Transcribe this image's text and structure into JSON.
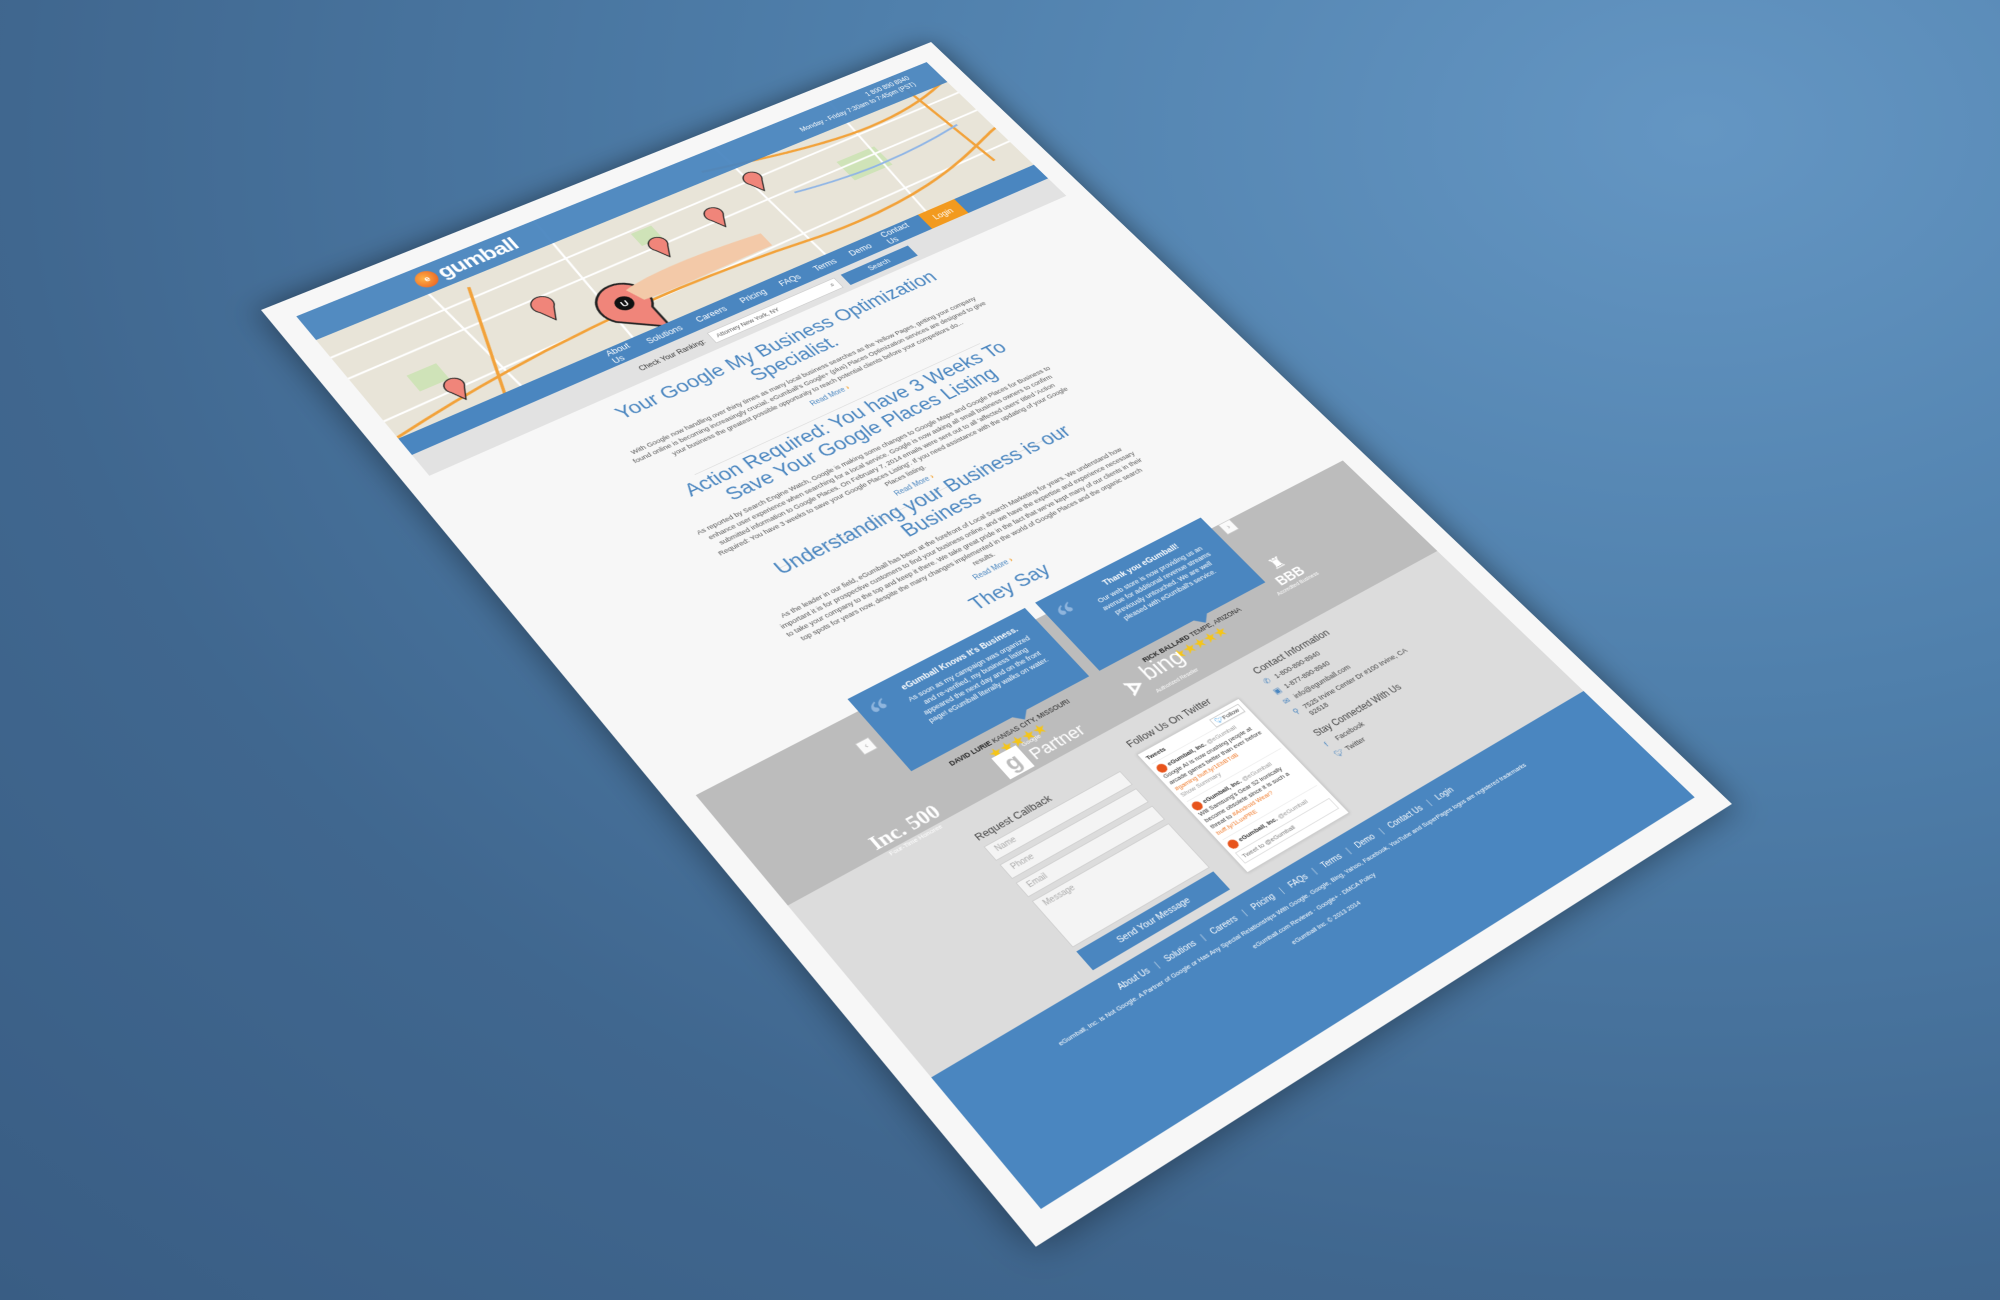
{
  "header": {
    "logo": "gumball",
    "logo_mark": "e",
    "phone": "1 800 890 8940",
    "hours": "Monday - Friday 7:30am to 7:45pm (PST)"
  },
  "nav": {
    "items": [
      "About Us",
      "Solutions",
      "Careers",
      "Pricing",
      "FAQs",
      "Terms",
      "Demo",
      "Contact Us"
    ],
    "login": "Login"
  },
  "ranking": {
    "label": "Check Your Ranking:",
    "value": "Attorney New York, NY",
    "button": "Search"
  },
  "articles": [
    {
      "title": "Your Google My Business Optimization Specialist.",
      "body": "With Google now handling over thirty times as many local business searches as the Yellow Pages, getting your company found online is becoming increasingly crucial. eGumball's Google+ (plus) Places Optimization services are designed to give your business the greatest possible opportunity to reach potential clients before your competitors do...",
      "more": "Read More"
    },
    {
      "title": "Action Required: You have 3 Weeks To Save Your Google Places Listing",
      "body": "As reported by Search Engine Watch, Google is making some changes to Google Maps and Google Places for Business to enhance user experience when searching for a local service. Google is now asking all small business owners to confirm submitted information to Google Places. On February 7, 2014 emails were sent out to all 'affected users' titled 'Action Required: You have 3 weeks to save your Google Places Listing'. If you need assistance with the updating of your Google Places listing.",
      "more": "Read More"
    },
    {
      "title": "Understanding your Business is our Business",
      "body": "As the leader in our field, eGumball has been at the forefront of Local Search Marketing for years. We understand how important it is for prospective customers to find your business online, and we have the expertise and experience necessary to take your company to the top and keep it there. We take great pride in the fact that we've kept many of our clients in their top spots for years now, despite the many changes implemented in the world of Google Places and the organic search results.",
      "more": "Read More"
    }
  ],
  "testimonials": {
    "title": "They Say",
    "items": [
      {
        "heading": "eGumball Knows It's Business.",
        "text": "As soon as my campaign was organized and re-verified, my business listing appeared the next day and on the front page! eGumball literally walks on water.",
        "name": "DAVID LURIE",
        "place": "KANSAS CITY, MISSOURI",
        "stars": "★★★★★",
        "rating": 5
      },
      {
        "heading": "Thank you eGumball!",
        "text": "Our web store is now providing us an avenue for additional revenue streams previously untouched. We are well pleased with eGumball's service.",
        "name": "RICK BALLARD",
        "place": "TEMPE, ARIZONA",
        "stars": "★★★★★",
        "rating": 5
      }
    ],
    "prev": "‹",
    "next": "›"
  },
  "partners": {
    "inc": "Inc. 500",
    "inc_sub": "Four-Time Honoree",
    "google_small": "Google",
    "google": "Partner",
    "bing": "bing",
    "bing_sub": "Authorized Reseller",
    "bbb": "BBB",
    "bbb_sub": "Accredited Business"
  },
  "callback": {
    "title": "Request Callback",
    "name": "Name",
    "phone": "Phone",
    "email": "Email",
    "message": "Message",
    "send": "Send Your Message"
  },
  "twitter": {
    "title": "Follow Us On Twitter",
    "follow": "Follow",
    "tweets_label": "Tweets",
    "account": "eGumball, Inc.",
    "handle": "@eGumball",
    "t1": "Google AI is now crushing people at arcade games better than ever before",
    "t1_link": "#gaming buff.ly/1EbBTdB",
    "summary": "Show Summary",
    "t2": "Will Samsung's Gear S2 ironically become obsolete since it is such a threat to",
    "t2_link": "#Android Wear? buff.ly/1LuxPRE",
    "compose": "Tweet to @eGumball"
  },
  "contact": {
    "title": "Contact Information",
    "phone1": "1-800-890-8940",
    "phone2": "1-877-890-8940",
    "email": "info@egumball.com",
    "address": "7525 Irvine Center Dr #100 Irvine, CA 92618",
    "social_title": "Stay Connected With Us",
    "facebook": "Facebook",
    "twitter": "Twitter"
  },
  "footer": {
    "links": [
      "About Us",
      "Solutions",
      "Careers",
      "Pricing",
      "FAQs",
      "Terms",
      "Demo",
      "Contact Us",
      "Login"
    ],
    "disclaimer": "eGumball, Inc. is Not Google. A Partner of Google or Has Any Special Relationships With Google. Google, Bing, Yahoo, Facebook, YouTube and SuperPages logos are registered trademarks",
    "reviews": "eGumball.com Reviews",
    "gplus": "Google+",
    "dmca": "DMCA Policy",
    "copyright": "eGumball Inc. © 2013 2014"
  },
  "colors": {
    "brand": "#4a86c0",
    "accent": "#f29a1f",
    "stars": "#f5c518"
  }
}
